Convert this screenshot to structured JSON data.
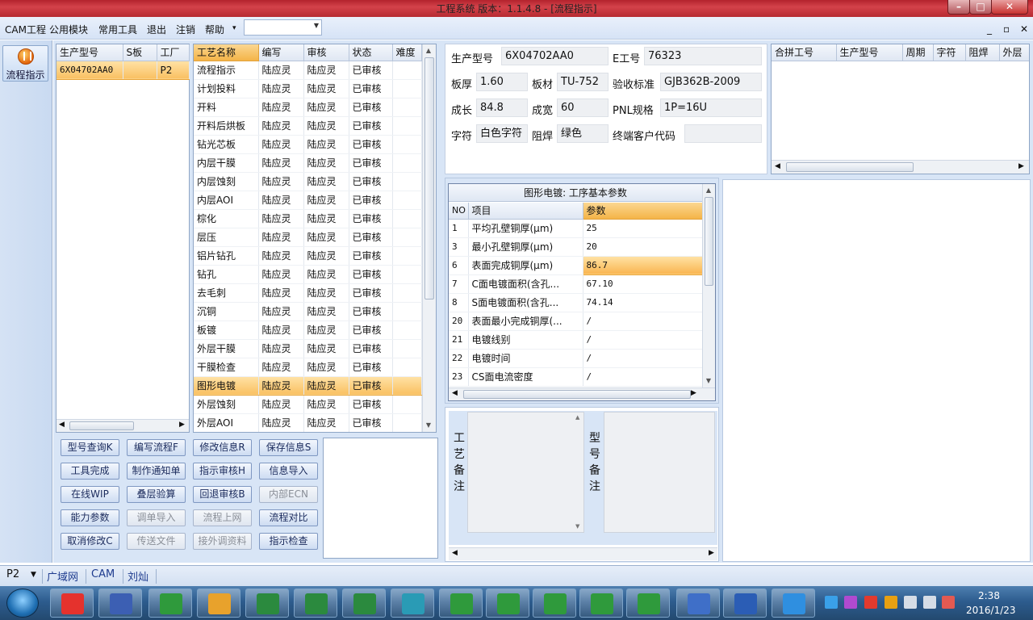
{
  "window": {
    "title": "工程系统  版本：1.1.4.8 - [流程指示]",
    "min": "–",
    "max": "□",
    "close": "✕"
  },
  "menu": {
    "items": [
      "CAM工程",
      "公用模块",
      "常用工具",
      "退出",
      "注销",
      "帮助"
    ],
    "help_arrow": "▾",
    "combo_value": "",
    "mdi": [
      "_",
      "▫",
      "✕"
    ]
  },
  "sidebar": {
    "flow_label": "流程指示"
  },
  "part_list": {
    "headers": [
      "生产型号",
      "S板",
      "工厂"
    ],
    "rows": [
      [
        "6X04702AA0",
        "",
        "P2"
      ]
    ]
  },
  "process_list": {
    "headers": [
      "工艺名称",
      "编写",
      "审核",
      "状态",
      "难度"
    ],
    "rows": [
      [
        "流程指示",
        "陆应灵",
        "陆应灵",
        "已审核",
        ""
      ],
      [
        "计划投料",
        "陆应灵",
        "陆应灵",
        "已审核",
        ""
      ],
      [
        "开料",
        "陆应灵",
        "陆应灵",
        "已审核",
        ""
      ],
      [
        "开料后烘板",
        "陆应灵",
        "陆应灵",
        "已审核",
        ""
      ],
      [
        "钻光芯板",
        "陆应灵",
        "陆应灵",
        "已审核",
        ""
      ],
      [
        "内层干膜",
        "陆应灵",
        "陆应灵",
        "已审核",
        ""
      ],
      [
        "内层蚀刻",
        "陆应灵",
        "陆应灵",
        "已审核",
        ""
      ],
      [
        "内层AOI",
        "陆应灵",
        "陆应灵",
        "已审核",
        ""
      ],
      [
        "棕化",
        "陆应灵",
        "陆应灵",
        "已审核",
        ""
      ],
      [
        "层压",
        "陆应灵",
        "陆应灵",
        "已审核",
        ""
      ],
      [
        "铝片钻孔",
        "陆应灵",
        "陆应灵",
        "已审核",
        ""
      ],
      [
        "钻孔",
        "陆应灵",
        "陆应灵",
        "已审核",
        ""
      ],
      [
        "去毛刺",
        "陆应灵",
        "陆应灵",
        "已审核",
        ""
      ],
      [
        "沉铜",
        "陆应灵",
        "陆应灵",
        "已审核",
        ""
      ],
      [
        "板镀",
        "陆应灵",
        "陆应灵",
        "已审核",
        ""
      ],
      [
        "外层干膜",
        "陆应灵",
        "陆应灵",
        "已审核",
        ""
      ],
      [
        "干膜检查",
        "陆应灵",
        "陆应灵",
        "已审核",
        ""
      ],
      [
        "图形电镀",
        "陆应灵",
        "陆应灵",
        "已审核",
        ""
      ],
      [
        "外层蚀刻",
        "陆应灵",
        "陆应灵",
        "已审核",
        ""
      ],
      [
        "外层AOI",
        "陆应灵",
        "陆应灵",
        "已审核",
        ""
      ]
    ],
    "selected_index": 17
  },
  "actions": [
    {
      "label": "型号查询K",
      "enabled": true
    },
    {
      "label": "编写流程F",
      "enabled": true
    },
    {
      "label": "修改信息R",
      "enabled": true
    },
    {
      "label": "保存信息S",
      "enabled": true
    },
    {
      "label": "工具完成",
      "enabled": true
    },
    {
      "label": "制作通知单",
      "enabled": true
    },
    {
      "label": "指示审核H",
      "enabled": true
    },
    {
      "label": "信息导入",
      "enabled": true
    },
    {
      "label": "在线WIP",
      "enabled": true
    },
    {
      "label": "叠层验算",
      "enabled": true
    },
    {
      "label": "回退审核B",
      "enabled": true
    },
    {
      "label": "内部ECN",
      "enabled": false
    },
    {
      "label": "能力参数",
      "enabled": true
    },
    {
      "label": "调单导入",
      "enabled": false
    },
    {
      "label": "流程上网",
      "enabled": false
    },
    {
      "label": "流程对比",
      "enabled": true
    },
    {
      "label": "取消修改C",
      "enabled": true
    },
    {
      "label": "传送文件",
      "enabled": false
    },
    {
      "label": "接外调资料",
      "enabled": false
    },
    {
      "label": "指示检查",
      "enabled": true
    }
  ],
  "info": {
    "prod_model_label": "生产型号",
    "prod_model": "6X04702AA0",
    "e_no_label": "E工号",
    "e_no": "76323",
    "thickness_label": "板厚",
    "thickness": "1.60",
    "material_label": "板材",
    "material": "TU-752",
    "standard_label": "验收标准",
    "standard": "GJB362B-2009",
    "length_label": "成长",
    "length": "84.8",
    "width_label": "成宽",
    "width": "60",
    "pnl_label": "PNL规格",
    "pnl": "1P=16U",
    "char_label": "字符",
    "char": "白色字符",
    "mask_label": "阻焊",
    "mask": "绿色",
    "customer_label": "终端客户代码",
    "customer": ""
  },
  "combined": {
    "headers": [
      "合拼工号",
      "生产型号",
      "周期",
      "字符",
      "阻焊",
      "外层"
    ]
  },
  "params": {
    "title": "图形电镀: 工序基本参数",
    "headers": [
      "NO",
      "项目",
      "参数"
    ],
    "rows": [
      [
        "1",
        "平均孔壁铜厚(μm)",
        "25"
      ],
      [
        "3",
        "最小孔壁铜厚(μm)",
        "20"
      ],
      [
        "6",
        "表面完成铜厚(μm)",
        "86.7"
      ],
      [
        "7",
        "C面电镀面积(含孔...",
        "67.10"
      ],
      [
        "8",
        "S面电镀面积(含孔...",
        "74.14"
      ],
      [
        "20",
        "表面最小完成铜厚(...",
        "/"
      ],
      [
        "21",
        "电镀线别",
        "/"
      ],
      [
        "22",
        "电镀时间",
        "/"
      ],
      [
        "23",
        "CS面电流密度",
        "/"
      ]
    ],
    "selected_index": 2
  },
  "remarks": {
    "process_label": "工艺备注",
    "model_label": "型号备注"
  },
  "status": {
    "factory": "P2",
    "network": "广域网",
    "dept": "CAM",
    "user": "刘灿"
  },
  "taskbar": {
    "time": "2:38",
    "date": "2016/1/23"
  }
}
